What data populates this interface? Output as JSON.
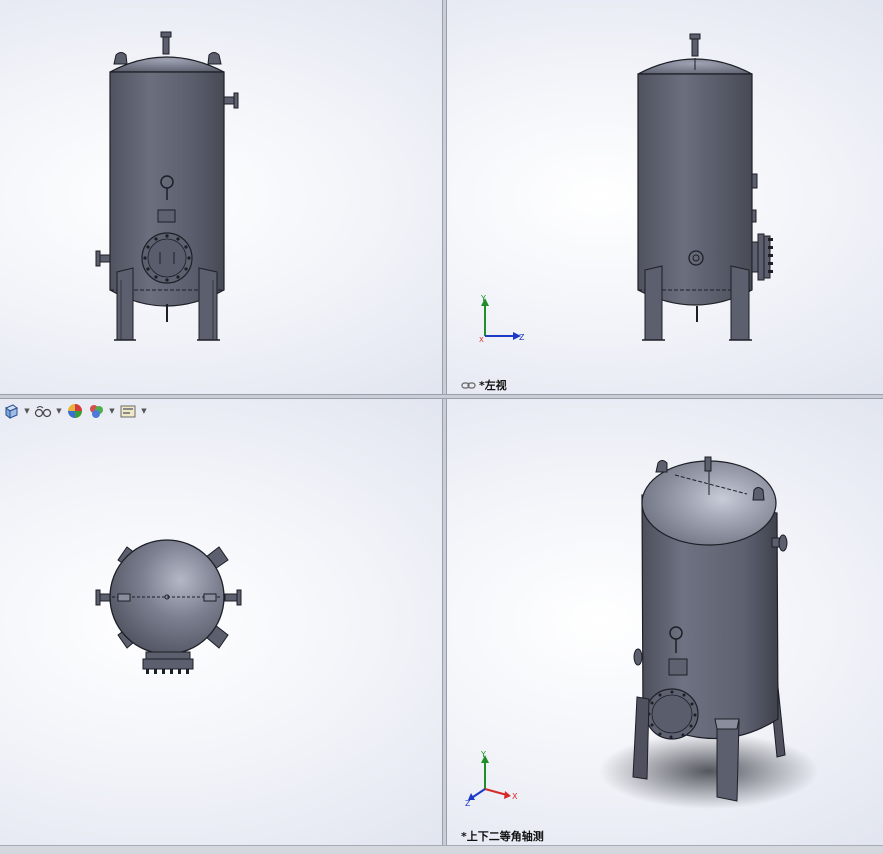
{
  "views": {
    "top_right": {
      "label": "*左视",
      "link_icon": "link-chain-icon"
    },
    "bottom_right": {
      "label": "*上下二等角轴测"
    }
  },
  "triad": {
    "x": "X",
    "y": "Y",
    "z": "Z"
  },
  "hud_toolbar": {
    "items": [
      "view-orientation-icon",
      "hide-show-items-icon",
      "edit-appearance-icon",
      "apply-scene-icon",
      "view-settings-icon"
    ]
  },
  "colors": {
    "vessel": "#5b5f6e",
    "vessel_highlight": "#8c90a0",
    "edge": "#1d1f26",
    "triad_x": "#d42a2a",
    "triad_y": "#1f8f2a",
    "triad_z": "#1c39c7"
  }
}
